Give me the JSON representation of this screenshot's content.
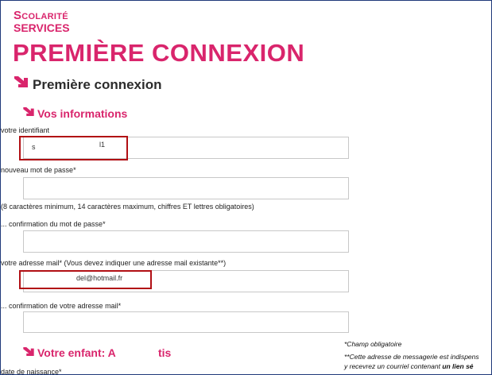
{
  "brand": {
    "line1": "Scolarité",
    "line2": "SERVICES"
  },
  "page_title": "PREMIÈRE CONNEXION",
  "section_title": "Première connexion",
  "subsection_info": "Vos informations",
  "form": {
    "identifiant_label": "votre identifiant",
    "identifiant_value_start": "s",
    "identifiant_value_end": "l1",
    "password_label": "nouveau mot de passe*",
    "password_hint": "(8 caractères minimum, 14 caractères maximum, chiffres ET lettres obligatoires)",
    "password_confirm_label": "... confirmation du mot de passe*",
    "email_label": "votre adresse mail* (Vous devez indiquer une adresse mail existante**)",
    "email_value": "del@hotmail.fr",
    "email_confirm_label": "... confirmation de votre adresse mail*",
    "birth_label": "date de naissance*"
  },
  "subsection_child": "Votre enfant: A",
  "subsection_child_tail": "tis",
  "notes": {
    "required": "*Champ obligatoire",
    "email_line1": "**Cette adresse de messagerie est indispens",
    "email_line2_start": "y recevrez un courriel contenant ",
    "email_line2_bold": "un lien sé"
  },
  "colors": {
    "accent": "#d9256c",
    "highlight": "#b10f14",
    "frame": "#1f3a7a"
  },
  "icons": [
    "arrow-down-right-icon"
  ]
}
